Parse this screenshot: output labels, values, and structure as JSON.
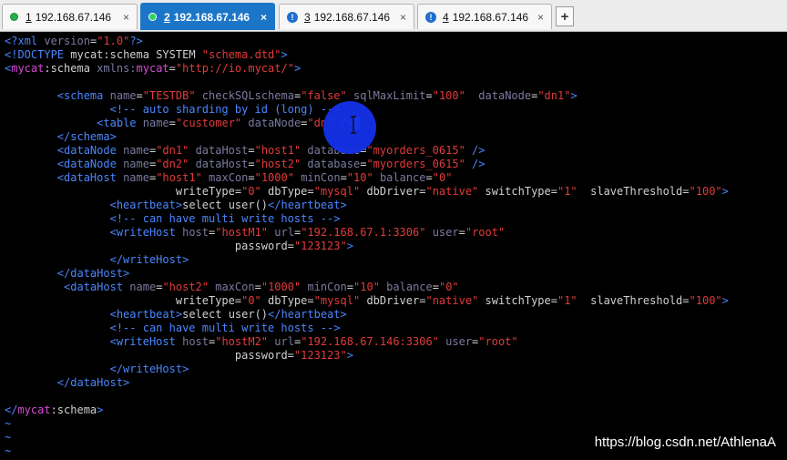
{
  "tabs": [
    {
      "number": "1",
      "title": "192.168.67.146",
      "status": "connected"
    },
    {
      "number": "2",
      "title": "192.168.67.146",
      "status": "connected",
      "active": true
    },
    {
      "number": "3",
      "title": "192.168.67.146",
      "status": "warning"
    },
    {
      "number": "4",
      "title": "192.168.67.146",
      "status": "none"
    }
  ],
  "tab_close_glyph": "×",
  "new_tab_glyph": "+",
  "editor": {
    "lines": [
      "<?xml version=\"1.0\"?>",
      "<!DOCTYPE mycat:schema SYSTEM \"schema.dtd\">",
      "<mycat:schema xmlns:mycat=\"http://io.mycat/\">",
      "",
      "        <schema name=\"TESTDB\" checkSQLschema=\"false\" sqlMaxLimit=\"100\"  dataNode=\"dn1\">",
      "                <!-- auto sharding by id (long) -->",
      "              <table name=\"customer\" dataNode=\"dn2\"/>",
      "        </schema>",
      "        <dataNode name=\"dn1\" dataHost=\"host1\" database=\"myorders_0615\" />",
      "        <dataNode name=\"dn2\" dataHost=\"host2\" database=\"myorders_0615\" />",
      "        <dataHost name=\"host1\" maxCon=\"1000\" minCon=\"10\" balance=\"0\"",
      "                          writeType=\"0\" dbType=\"mysql\" dbDriver=\"native\" switchType=\"1\"  slaveThreshold=\"100\">",
      "                <heartbeat>select user()</heartbeat>",
      "                <!-- can have multi write hosts -->",
      "                <writeHost host=\"hostM1\" url=\"192.168.67.1:3306\" user=\"root\"",
      "                                   password=\"123123\">",
      "                </writeHost>",
      "        </dataHost>",
      "         <dataHost name=\"host2\" maxCon=\"1000\" minCon=\"10\" balance=\"0\"",
      "                          writeType=\"0\" dbType=\"mysql\" dbDriver=\"native\" switchType=\"1\"  slaveThreshold=\"100\">",
      "                <heartbeat>select user()</heartbeat>",
      "                <!-- can have multi write hosts -->",
      "                <writeHost host=\"hostM2\" url=\"192.168.67.146:3306\" user=\"root\"",
      "                                   password=\"123123\">",
      "                </writeHost>",
      "        </dataHost>",
      "",
      "</mycat:schema>"
    ],
    "empty_line_marker": "~",
    "empty_marker_count": 3
  },
  "watermark": "https://blog.csdn.net/AthlenaA",
  "colors": {
    "tab_active": "#1c76c8",
    "tag": "#4a86ff",
    "value": "#e23b3b",
    "namespace": "#d64bd6",
    "click_indicator": "#1430e8"
  }
}
